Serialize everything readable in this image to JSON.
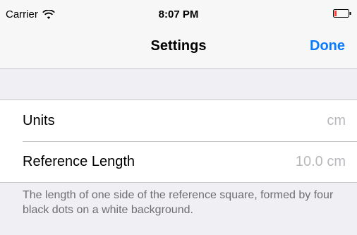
{
  "status_bar": {
    "carrier": "Carrier",
    "time": "8:07 PM",
    "battery_color": "#ff3b30"
  },
  "nav": {
    "title": "Settings",
    "done_label": "Done",
    "accent": "#0a7aff"
  },
  "settings": {
    "rows": [
      {
        "label": "Units",
        "value": "cm"
      },
      {
        "label": "Reference Length",
        "value": "10.0 cm"
      }
    ],
    "footer": "The length of one side of the reference square, formed by four black dots on a white background."
  }
}
